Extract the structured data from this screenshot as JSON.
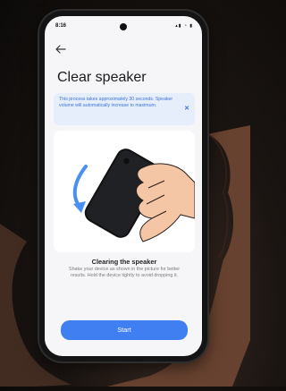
{
  "status": {
    "time": "8:16",
    "icons": "▴▮ ◔ ▮"
  },
  "page": {
    "title": "Clear speaker",
    "banner_text": "This process takes approximately 30 seconds. Speaker volume will automatically increase to maximum.",
    "caption_title": "Clearing the speaker",
    "caption_text": "Shake your device as shown in the picture for better results. Hold the device tightly to avoid dropping it.",
    "start_label": "Start"
  },
  "icons": {
    "back": "arrow-left",
    "close": "close",
    "motion": "curved-arrow-down"
  },
  "colors": {
    "accent": "#3f7ff2",
    "banner_bg": "#e6eefb",
    "banner_text": "#3b73d8",
    "screen_bg": "#f6f6f8"
  }
}
